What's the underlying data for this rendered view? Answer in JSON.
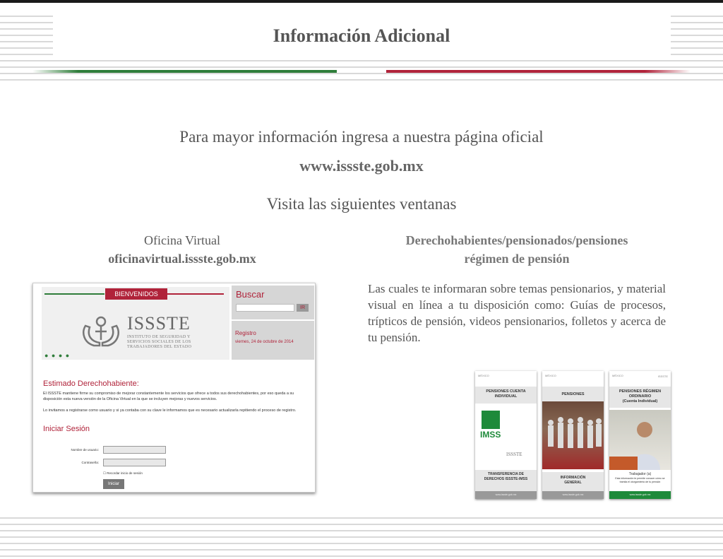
{
  "header": {
    "title": "Información Adicional"
  },
  "intro": {
    "text": "Para mayor información ingresa a nuestra página oficial",
    "url": "www.issste.gob.mx",
    "visit": "Visita las siguientes ventanas"
  },
  "left_column": {
    "label": "Oficina Virtual",
    "url": "oficinavirtual.issste.gob.mx"
  },
  "right_column": {
    "line1": "Derechohabientes/pensionados/pensiones",
    "line2": "régimen de pensión",
    "paragraph": "Las cuales te informaran sobre temas pensionarios, y material visual en línea a tu disposición como: Guías de procesos, trípticos de pensión, videos pensionarios, folletos y acerca de tu pensión."
  },
  "screenshot": {
    "welcome": "BIENVENIDOS",
    "brand": "ISSSTE",
    "brand_sub": "INSTITUTO DE SEGURIDAD Y SERVICIOS SOCIALES DE LOS TRABAJADORES DEL ESTADO",
    "search_label": "Buscar",
    "search_button": "IR",
    "registro": "Registro",
    "date": "viernes, 24 de octubre de 2014",
    "greeting": "Estimado Derechohabiente:",
    "message1": "El ISSSTE mantiene firme su compromiso de mejorar constantemente los servicios que ofrece a todos sus derechohabientes, por eso queda a su disposición esta nueva versión de la Oficina Virtual en la que se incluyen mejoras y nuevos servicios.",
    "message2": "Lo invitamos a registrarse como usuario y si ya contaba con su clave le informamos que es necesario actualizarla repitiendo el proceso de registro.",
    "login_title": "Iniciar Sesión",
    "user_label": "Nombre de usuario:",
    "password_label": "Contraseña:",
    "remember": "Recordar inicio de sesión",
    "login_button": "Iniciar"
  },
  "brochures": [
    {
      "header_left": "MÉXICO",
      "header_right": "",
      "title": "PENSIONES CUENTA INDIVIDUAL",
      "logo1": "IMSS",
      "logo2": "ISSSTE",
      "footer": "TRANSFERENCIA DE DERECHOS ISSSTE-IMSS",
      "url": "www.issste.gob.mx"
    },
    {
      "header_left": "MÉXICO",
      "header_right": "",
      "title": "PENSIONES",
      "footer": "INFORMACIÓN GENERAL",
      "url": "www.issste.gob.mx"
    },
    {
      "header_left": "MÉXICO",
      "header_right": "ISSSTE",
      "title": "PENSIONES RÉGIMEN ORDINARIO",
      "subtitle": "(Cuenta Individual)",
      "footer_title": "Trabajador (a)",
      "footer": "Esta información te permite conocer cómo se tramita el otorgamiento de tu pensión",
      "url": "www.issste.gob.mx"
    }
  ],
  "colors": {
    "green": "#2f7d3a",
    "red": "#b0233a",
    "text": "#555555"
  }
}
